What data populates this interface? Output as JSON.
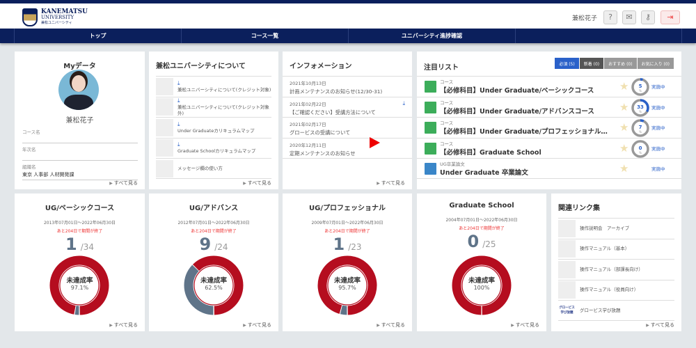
{
  "header": {
    "logo": {
      "line1": "KANEMATSU",
      "line2": "UNIVERSITY",
      "line3": "兼松ユニバーシティ"
    },
    "user_name": "兼松花子",
    "icons": [
      "help-icon",
      "mail-icon",
      "key-icon",
      "logout-icon"
    ]
  },
  "nav": [
    "トップ",
    "コース一覧",
    "ユニバーシティ進捗確認",
    ""
  ],
  "mydata": {
    "title": "Myデータ",
    "name": "兼松花子",
    "fields": [
      {
        "label": "コース名",
        "value": ""
      },
      {
        "label": "年次名",
        "value": ""
      },
      {
        "label": "組織名",
        "value": "東京 人事部 人材開発課"
      }
    ],
    "more": "すべて見る"
  },
  "about": {
    "title": "兼松ユニバーシティについて",
    "items": [
      {
        "label": "兼松ユニバーシティについて(クレジット対象)",
        "download": true
      },
      {
        "label": "兼松ユニバーシティについて(クレジット対象外)",
        "download": true
      },
      {
        "label": "Under Graduateカリキュラムマップ",
        "download": true
      },
      {
        "label": "Graduate Schoolカリキュラムマップ",
        "download": true
      },
      {
        "label": "メッセージ欄の使い方",
        "download": false
      }
    ],
    "more": "すべて見る"
  },
  "info": {
    "title": "インフォメーション",
    "items": [
      {
        "date": "2021年10月13日",
        "text": "計画メンテナンスのお知らせ(12/30-31)",
        "download": false
      },
      {
        "date": "2021年02月22日",
        "text": "【ご確認ください】受講方法について",
        "download": true
      },
      {
        "date": "2021年02月17日",
        "text": "グロービスの受講について",
        "download": false
      },
      {
        "date": "2020年12月11日",
        "text": "定期メンテナンスのお知らせ",
        "download": false
      }
    ],
    "more": "すべて見る"
  },
  "watch": {
    "title": "注目リスト",
    "tabs": [
      {
        "label": "必須 (5)",
        "active": true
      },
      {
        "label": "新着 (0)"
      },
      {
        "label": "おすすめ (0)"
      },
      {
        "label": "お気に入り (0)"
      }
    ],
    "items": [
      {
        "category": "コース",
        "name": "【必修科目】Under Graduate/ベーシックコース",
        "progress": 5,
        "unit": "%",
        "status": "実施中"
      },
      {
        "category": "コース",
        "name": "【必修科目】Under Graduate/アドバンスコース",
        "progress": 33,
        "unit": "%",
        "status": "実施中"
      },
      {
        "category": "コース",
        "name": "【必修科目】Under Graduate/プロフェッショナルコース",
        "progress": 7,
        "unit": "%",
        "status": "実施中"
      },
      {
        "category": "コース",
        "name": "【必修科目】Graduate School",
        "progress": 0,
        "unit": "%",
        "status": "実施中"
      },
      {
        "category": "UG卒業論文",
        "name": "Under Graduate 卒業論文",
        "progress": null,
        "status": "実施中"
      }
    ]
  },
  "courses": [
    {
      "title": "UG/ベーシックコース",
      "period": "2013年07月01日～2022年06月30日",
      "warning": "あと204日で期間が終了",
      "done": "1",
      "total": "/34",
      "label": "未達成率",
      "rate": "97.1%",
      "rate_value": 97.1,
      "more": "すべて見る"
    },
    {
      "title": "UG/アドバンス",
      "period": "2012年07月01日～2022年06月30日",
      "warning": "あと204日で期間が終了",
      "done": "9",
      "total": "/24",
      "label": "未達成率",
      "rate": "62.5%",
      "rate_value": 62.5,
      "more": "すべて見る"
    },
    {
      "title": "UG/プロフェッショナル",
      "period": "2009年07月01日～2022年06月30日",
      "warning": "あと204日で期間が終了",
      "done": "1",
      "total": "/23",
      "label": "未達成率",
      "rate": "95.7%",
      "rate_value": 95.7,
      "more": "すべて見る"
    },
    {
      "title": "Graduate School",
      "period": "2004年07月01日～2022年06月30日",
      "warning": "あと204日で期間が終了",
      "done": "0",
      "total": "/25",
      "label": "未達成率",
      "rate": "100%",
      "rate_value": 100,
      "more": "すべて見る"
    }
  ],
  "links": {
    "title": "関連リンク集",
    "items": [
      "操作説明会　アーカイブ",
      "操作マニュアル（基本）",
      "操作マニュアル（部課長向け）",
      "操作マニュアル（役員向け）",
      "グロービス学び放題"
    ],
    "globis_thumb": "グロービス学び放題",
    "more": "すべて見る"
  },
  "colors": {
    "navy": "#0b1f5c",
    "red": "#b50d1f",
    "gray": "#5f7489",
    "blue": "#2a61c9",
    "green": "#3cad5a"
  }
}
